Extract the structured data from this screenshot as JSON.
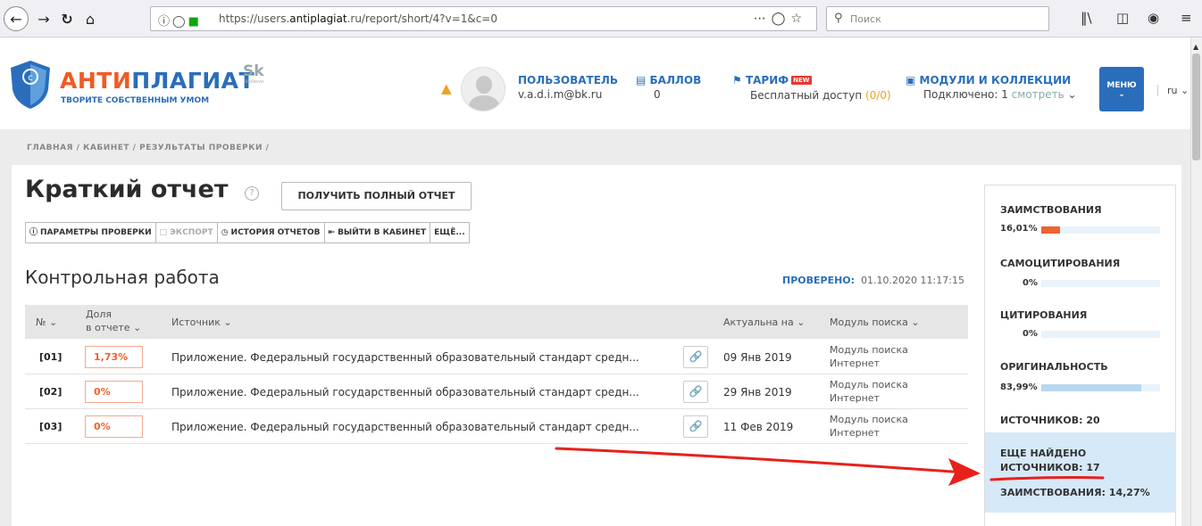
{
  "browser": {
    "url_prefix": "https://users.",
    "url_host": "antiplagiat",
    "url_suffix": ".ru/report/short/4?v=1&c=0",
    "search_placeholder": "Поиск",
    "icons": [
      "back-icon",
      "forward-icon",
      "reload-icon",
      "home-icon",
      "info-icon",
      "shield-icon",
      "lock-icon",
      "more-icon",
      "pocket-icon",
      "star-icon",
      "library-icon",
      "sidebar-icon",
      "account-icon",
      "menu-icon"
    ]
  },
  "header": {
    "logo_part1": "АНТИ",
    "logo_part2": "ПЛАГИАТ",
    "tagline": "ТВОРИТЕ СОБСТВЕННЫМ УМОМ",
    "sk_logo": "Sk",
    "sk_sub": "Skolkovo",
    "user_label": "ПОЛЬЗОВАТЕЛЬ",
    "user_email": "v.a.d.i.m@bk.ru",
    "points_label": "БАЛЛОВ",
    "points_value": "0",
    "tariff_label": "ТАРИФ",
    "tariff_badge": "NEW",
    "tariff_value": "Бесплатный доступ",
    "tariff_count": "(0/0)",
    "modules_label": "МОДУЛИ И КОЛЛЕКЦИИ",
    "modules_value": "Подключено: 1",
    "modules_link": "смотреть",
    "menu_label": "МЕНЮ",
    "lang": "ru"
  },
  "breadcrumb": "ГЛАВНАЯ / КАБИНЕТ / РЕЗУЛЬТАТЫ ПРОВЕРКИ /",
  "report": {
    "title": "Краткий отчет",
    "full_report_button": "ПОЛУЧИТЬ ПОЛНЫЙ ОТЧЕТ",
    "toolbar": {
      "params": "ПАРАМЕТРЫ ПРОВЕРКИ",
      "export": "ЭКСПОРТ",
      "history": "ИСТОРИЯ ОТЧЕТОВ",
      "exit": "ВЫЙТИ В КАБИНЕТ",
      "more": "ЕЩЁ..."
    },
    "work_title": "Контрольная работа",
    "checked_label": "ПРОВЕРЕНО:",
    "checked_value": "01.10.2020 11:17:15"
  },
  "table": {
    "headers": {
      "num": "№",
      "share_line1": "Доля",
      "share_line2": "в отчете",
      "source": "Источник",
      "actual": "Актуальна на",
      "module": "Модуль поиска"
    },
    "rows": [
      {
        "num": "[01]",
        "share": "1,73%",
        "source": "Приложение. Федеральный государственный образовательный стандарт средн...",
        "date": "09 Янв 2019",
        "module_line1": "Модуль поиска",
        "module_line2": "Интернет"
      },
      {
        "num": "[02]",
        "share": "0%",
        "source": "Приложение. Федеральный государственный образовательный стандарт средн...",
        "date": "29 Янв 2019",
        "module_line1": "Модуль поиска",
        "module_line2": "Интернет"
      },
      {
        "num": "[03]",
        "share": "0%",
        "source": "Приложение. Федеральный государственный образовательный стандарт средн...",
        "date": "11 Фев 2019",
        "module_line1": "Модуль поиска",
        "module_line2": "Интернет"
      }
    ]
  },
  "sidebar": {
    "borrowings_label": "ЗАИМСТВОВАНИЯ",
    "borrowings_value": "16,01%",
    "borrowings_fraction": 0.1601,
    "selfcite_label": "САМОЦИТИРОВАНИЯ",
    "selfcite_value": "0%",
    "selfcite_fraction": 0,
    "cite_label": "ЦИТИРОВАНИЯ",
    "cite_value": "0%",
    "cite_fraction": 0,
    "originality_label": "ОРИГИНАЛЬНОСТЬ",
    "originality_value": "83,99%",
    "originality_fraction": 0.8399,
    "sources": "ИСТОЧНИКОВ: 20",
    "more_found_line1": "ЕЩЕ НАЙДЕНО",
    "more_found_line2": "ИСТОЧНИКОВ: 17",
    "more_borrowings": "ЗАИМСТВОВАНИЯ: 14,27%",
    "colors": {
      "borrowings": "#f0622e",
      "originality": "#b9d7f0",
      "track": "#e9f3fb"
    }
  }
}
